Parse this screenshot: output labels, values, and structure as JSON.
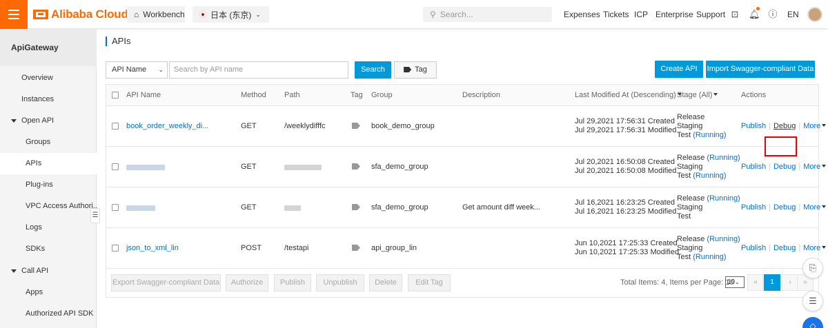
{
  "topbar": {
    "brand": "Alibaba Cloud",
    "workbench": "Workbench",
    "region": "日本 (东京)",
    "search_placeholder": "Search...",
    "nav": [
      "Expenses",
      "Tickets",
      "ICP",
      "Enterprise",
      "Support"
    ],
    "lang": "EN"
  },
  "sidebar": {
    "title": "ApiGateway",
    "items": {
      "overview": "Overview",
      "instances": "Instances",
      "open_api": "Open API",
      "groups": "Groups",
      "apis": "APIs",
      "plugins": "Plug-ins",
      "vpc": "VPC Access Authori...",
      "logs": "Logs",
      "sdks": "SDKs",
      "call_api": "Call API",
      "apps": "Apps",
      "authorized_sdk": "Authorized API SDK"
    }
  },
  "main": {
    "title": "APIs",
    "filter_select": "API Name",
    "search_placeholder": "Search by API name",
    "search_button": "Search",
    "tag_button": "Tag",
    "create_button": "Create API",
    "import_button": "Import Swagger-compliant Data"
  },
  "table": {
    "headers": {
      "name": "API Name",
      "method": "Method",
      "path": "Path",
      "tag": "Tag",
      "group": "Group",
      "description": "Description",
      "modified": "Last Modified At (Descending)",
      "stage": "Stage (All)",
      "actions": "Actions"
    },
    "rows": [
      {
        "name": "book_order_weekly_di...",
        "method": "GET",
        "path": "/weeklydifffc",
        "group": "book_demo_group",
        "description": "",
        "created": "Jul 29,2021 17:56:31 Created",
        "modified": "Jul 29,2021 17:56:31 Modified",
        "stage1": "Release",
        "stage1_running": "",
        "stage2": "Staging",
        "stage3": "Test",
        "stage3_running": "(Running)"
      },
      {
        "name": "",
        "method": "GET",
        "path": "",
        "group": "sfa_demo_group",
        "description": "",
        "created": "Jul 20,2021 16:50:08 Created",
        "modified": "Jul 20,2021 16:50:08 Modified",
        "stage1": "Release",
        "stage1_running": "(Running)",
        "stage2": "Staging",
        "stage3": "Test",
        "stage3_running": "(Running)"
      },
      {
        "name": "",
        "method": "GET",
        "path": "",
        "group": "sfa_demo_group",
        "description": "Get amount diff week...",
        "created": "Jul 16,2021 16:23:25 Created",
        "modified": "Jul 16,2021 16:23:25 Modified",
        "stage1": "Release",
        "stage1_running": "(Running)",
        "stage2": "Staging",
        "stage3": "Test",
        "stage3_running": ""
      },
      {
        "name": "json_to_xml_lin",
        "method": "POST",
        "path": "/testapi",
        "group": "api_group_lin",
        "description": "",
        "created": "Jun 10,2021 17:25:33 Created",
        "modified": "Jun 10,2021 17:25:33 Modified",
        "stage1": "Release",
        "stage1_running": "(Running)",
        "stage2": "Staging",
        "stage3": "Test",
        "stage3_running": "(Running)"
      }
    ],
    "actions": {
      "publish": "Publish",
      "debug": "Debug",
      "more": "More"
    }
  },
  "footer": {
    "export": "Export Swagger-compliant Data",
    "authorize": "Authorize",
    "publish": "Publish",
    "unpublish": "Unpublish",
    "delete": "Delete",
    "edit_tag": "Edit Tag",
    "total": "Total Items: 4, Items per Page: 10",
    "page_size": "10",
    "page_first": "«",
    "page_prev": "‹",
    "page_current": "1",
    "page_next": "›",
    "page_last": "»"
  },
  "colors": {
    "brand": "#ff6a00",
    "primary": "#0099da",
    "link": "#0070cc",
    "highlight": "#ee0000"
  }
}
